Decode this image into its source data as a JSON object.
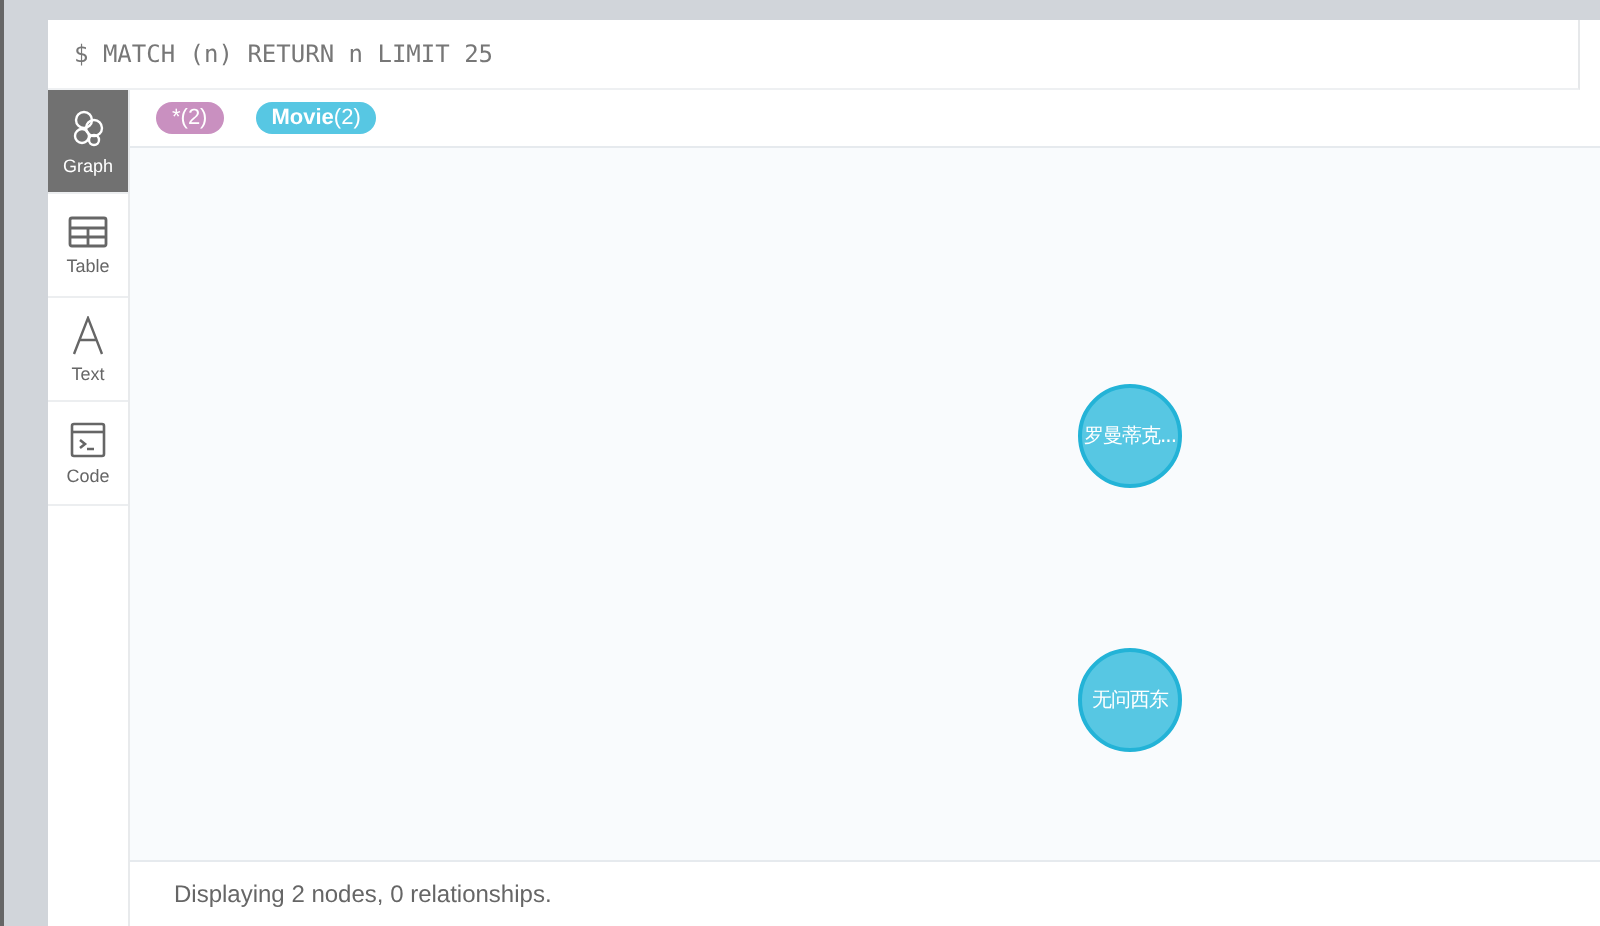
{
  "query": {
    "text": "$ MATCH (n) RETURN n LIMIT 25"
  },
  "sidebar": {
    "items": [
      {
        "kind": "graph",
        "label": "Graph",
        "selected": true
      },
      {
        "kind": "table",
        "label": "Table",
        "selected": false
      },
      {
        "kind": "text",
        "label": "Text",
        "selected": false
      },
      {
        "kind": "code",
        "label": "Code",
        "selected": false
      }
    ]
  },
  "legend": {
    "labels": [
      {
        "name": "*",
        "count": "(2)",
        "color": "#c990c0",
        "bold": false
      },
      {
        "name": "Movie",
        "count": "(2)",
        "color": "#57c7e3",
        "bold": true
      }
    ]
  },
  "graph": {
    "nodes": [
      {
        "caption": "罗曼蒂克...",
        "color": "#57c7e3"
      },
      {
        "caption": "无问西东",
        "color": "#57c7e3"
      }
    ]
  },
  "status_bar": {
    "text": "Displaying 2 nodes, 0 relationships."
  }
}
